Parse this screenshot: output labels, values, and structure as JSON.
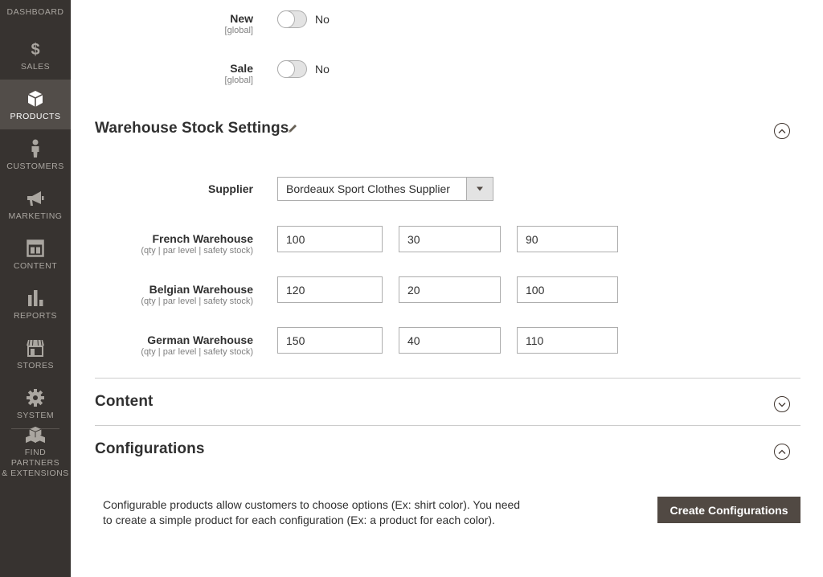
{
  "sidebar": {
    "items": [
      {
        "label": "Dashboard",
        "icon": "dashboard-icon"
      },
      {
        "label": "Sales",
        "icon": "dollar-icon"
      },
      {
        "label": "Products",
        "icon": "box-icon"
      },
      {
        "label": "Customers",
        "icon": "person-icon"
      },
      {
        "label": "Marketing",
        "icon": "megaphone-icon"
      },
      {
        "label": "Content",
        "icon": "layout-icon"
      },
      {
        "label": "Reports",
        "icon": "bar-chart-icon"
      },
      {
        "label": "Stores",
        "icon": "storefront-icon"
      },
      {
        "label": "System",
        "icon": "gear-icon"
      },
      {
        "label_line1": "Find Partners",
        "label_line2": "& Extensions",
        "icon": "cubes-icon"
      }
    ],
    "active": "Products"
  },
  "attributes": {
    "new": {
      "label": "New",
      "scope": "[global]",
      "value": "No"
    },
    "sale": {
      "label": "Sale",
      "scope": "[global]",
      "value": "No"
    }
  },
  "warehouse_section": {
    "title": "Warehouse Stock Settings",
    "supplier_label": "Supplier",
    "supplier_value": "Bordeaux Sport Clothes Supplier",
    "hint": "(qty | par level | safety stock)",
    "warehouses": [
      {
        "name": "French Warehouse",
        "qty": "100",
        "par_level": "30",
        "safety_stock": "90"
      },
      {
        "name": "Belgian Warehouse",
        "qty": "120",
        "par_level": "20",
        "safety_stock": "100"
      },
      {
        "name": "German Warehouse",
        "qty": "150",
        "par_level": "40",
        "safety_stock": "110"
      }
    ]
  },
  "content_section": {
    "title": "Content"
  },
  "configurations_section": {
    "title": "Configurations",
    "description": "Configurable products allow customers to choose options (Ex: shirt color). You need to create a simple product for each configuration (Ex: a product for each color).",
    "button_label": "Create Configurations"
  },
  "colors": {
    "sidebar_bg": "#373330",
    "sidebar_active": "#524d49",
    "primary_button": "#514943"
  }
}
